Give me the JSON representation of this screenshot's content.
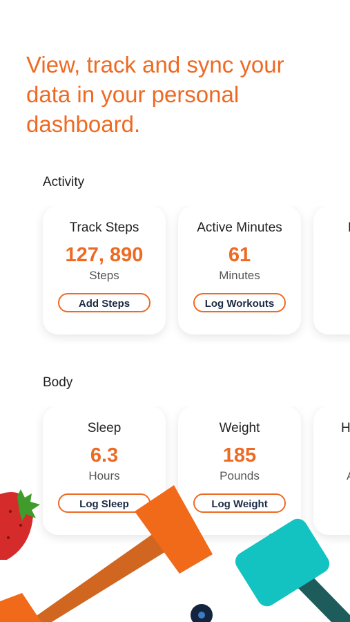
{
  "headline": "View, track and sync your data in your personal dashboard.",
  "colors": {
    "accent": "#ee6a23",
    "button_text": "#1b2a44"
  },
  "sections": {
    "activity": {
      "label": "Activity",
      "cards": [
        {
          "title": "Track Steps",
          "value": "127, 890",
          "unit": "Steps",
          "button": "Add Steps"
        },
        {
          "title": "Active Minutes",
          "value": "61",
          "unit": "Minutes",
          "button": "Log Workouts"
        },
        {
          "title": "D"
        }
      ]
    },
    "body": {
      "label": "Body",
      "cards": [
        {
          "title": "Sleep",
          "value": "6.3",
          "unit": "Hours",
          "button": "Log Sleep"
        },
        {
          "title": "Weight",
          "value": "185",
          "unit": "Pounds",
          "button": "Log Weight"
        },
        {
          "title": "H",
          "unit": "A"
        }
      ]
    }
  },
  "illustration": {
    "icons": [
      "strawberry-icon",
      "hammer-icon",
      "dumbbell-icon"
    ]
  }
}
